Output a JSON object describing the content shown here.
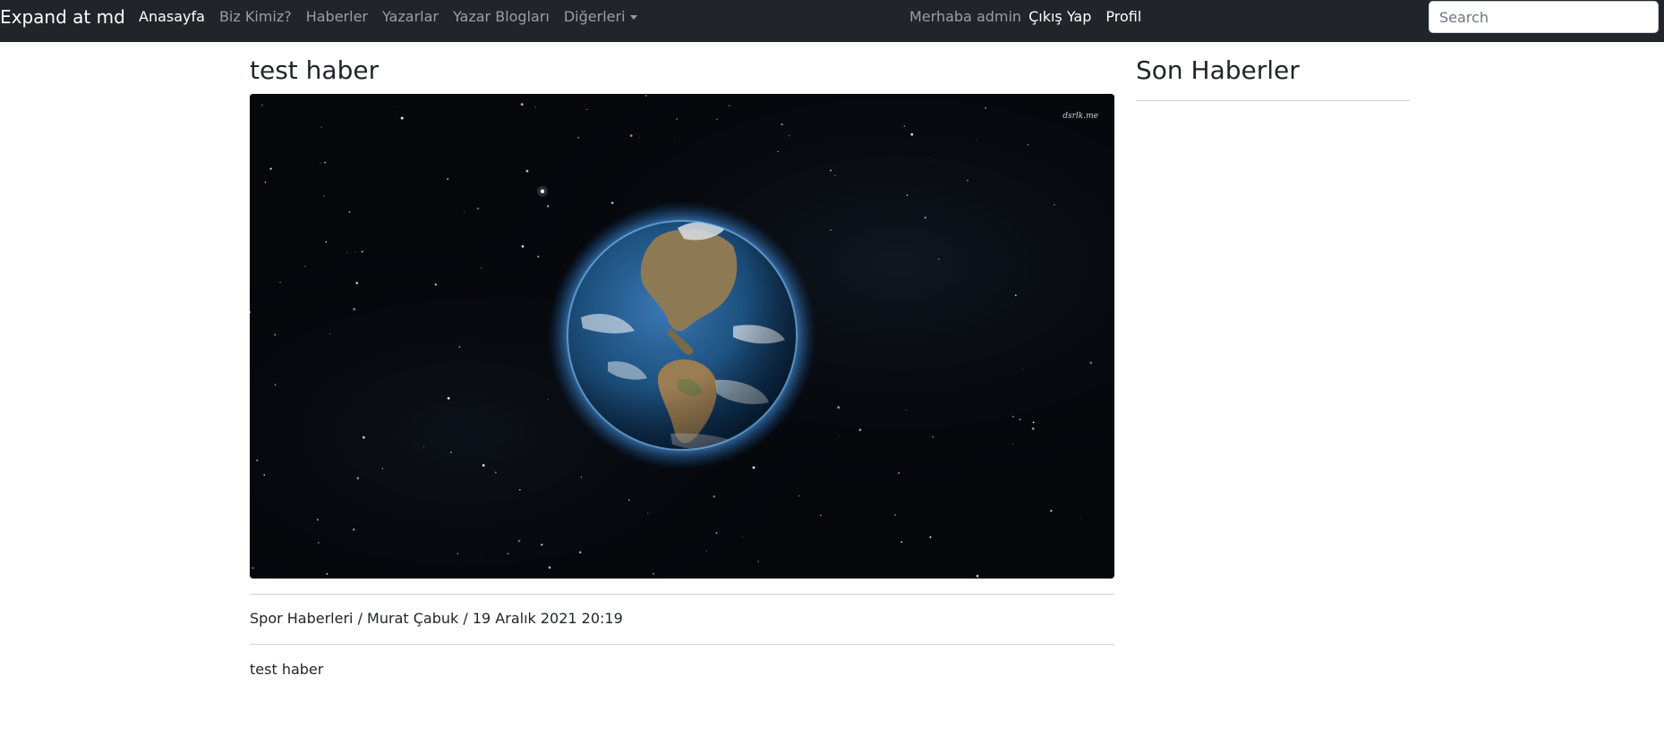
{
  "navbar": {
    "brand": "Expand at md",
    "links": [
      {
        "label": "Anasayfa"
      },
      {
        "label": "Biz Kimiz?"
      },
      {
        "label": "Haberler"
      },
      {
        "label": "Yazarlar"
      },
      {
        "label": "Yazar Blogları"
      },
      {
        "label": "Diğerleri"
      }
    ],
    "greeting": "Merhaba admin",
    "logout": "Çıkış Yap",
    "profile": "Profil",
    "search_placeholder": "Search"
  },
  "article": {
    "title": "test haber",
    "image": {
      "watermark": "dsrlk.me"
    },
    "meta": "Spor Haberleri / Murat Çabuk / 19 Aralık 2021 20:19",
    "body": "test haber"
  },
  "sidebar": {
    "title": "Son Haberler"
  },
  "colors": {
    "navbar_bg": "#212529",
    "space_bg": "#05070b",
    "ocean": "#1c4f7c"
  }
}
